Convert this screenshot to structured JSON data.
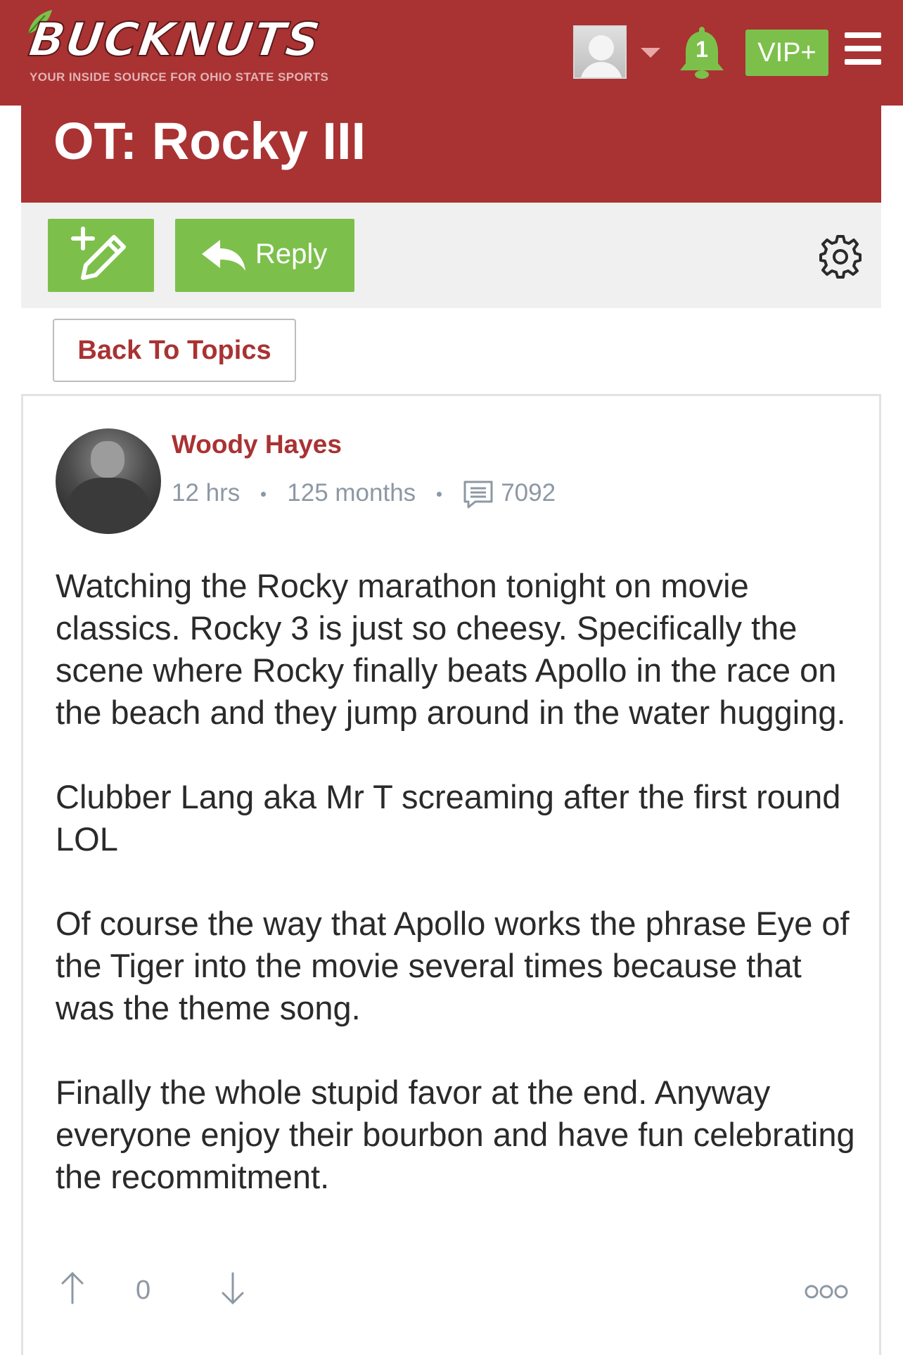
{
  "header": {
    "logo_text": "BUCKNUTS",
    "logo_tagline": "YOUR INSIDE SOURCE FOR OHIO STATE SPORTS",
    "notification_count": "1",
    "vip_label": "VIP+",
    "colors": {
      "brand": "#a93233",
      "accent_green": "#7cc04b",
      "bell_green": "#7cc04b"
    }
  },
  "thread": {
    "title": "OT: Rocky III"
  },
  "toolbar": {
    "new_post_icon": "new-post-pen-icon",
    "reply_label": "Reply",
    "settings_icon": "gear-icon"
  },
  "nav": {
    "back_label": "Back To Topics"
  },
  "post": {
    "author": "Woody Hayes",
    "posted_ago": "12 hrs",
    "member_for": "125 months",
    "post_count": "7092",
    "paragraphs": [
      "Watching the Rocky marathon tonight on movie classics. Rocky 3 is just so cheesy. Specifically the scene where Rocky finally beats Apollo in the race on the beach and they jump around in the water hugging.",
      "Clubber Lang aka Mr T screaming after the first round LOL",
      "Of course the way that Apollo works the phrase Eye of the Tiger into the movie several times because that was the theme song.",
      "Finally the whole stupid favor at the end. Anyway everyone enjoy their bourbon and have fun celebrating the recommitment."
    ],
    "vote_count": "0"
  }
}
